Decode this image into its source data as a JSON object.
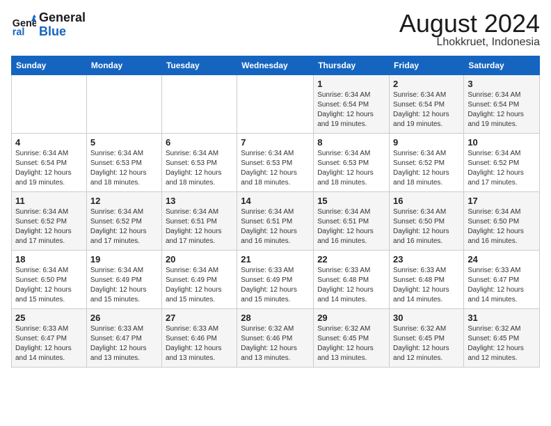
{
  "header": {
    "logo_line1": "General",
    "logo_line2": "Blue",
    "title": "August 2024",
    "subtitle": "Lhokkruet, Indonesia"
  },
  "weekdays": [
    "Sunday",
    "Monday",
    "Tuesday",
    "Wednesday",
    "Thursday",
    "Friday",
    "Saturday"
  ],
  "weeks": [
    [
      {
        "day": "",
        "info": ""
      },
      {
        "day": "",
        "info": ""
      },
      {
        "day": "",
        "info": ""
      },
      {
        "day": "",
        "info": ""
      },
      {
        "day": "1",
        "info": "Sunrise: 6:34 AM\nSunset: 6:54 PM\nDaylight: 12 hours\nand 19 minutes."
      },
      {
        "day": "2",
        "info": "Sunrise: 6:34 AM\nSunset: 6:54 PM\nDaylight: 12 hours\nand 19 minutes."
      },
      {
        "day": "3",
        "info": "Sunrise: 6:34 AM\nSunset: 6:54 PM\nDaylight: 12 hours\nand 19 minutes."
      }
    ],
    [
      {
        "day": "4",
        "info": "Sunrise: 6:34 AM\nSunset: 6:54 PM\nDaylight: 12 hours\nand 19 minutes."
      },
      {
        "day": "5",
        "info": "Sunrise: 6:34 AM\nSunset: 6:53 PM\nDaylight: 12 hours\nand 18 minutes."
      },
      {
        "day": "6",
        "info": "Sunrise: 6:34 AM\nSunset: 6:53 PM\nDaylight: 12 hours\nand 18 minutes."
      },
      {
        "day": "7",
        "info": "Sunrise: 6:34 AM\nSunset: 6:53 PM\nDaylight: 12 hours\nand 18 minutes."
      },
      {
        "day": "8",
        "info": "Sunrise: 6:34 AM\nSunset: 6:53 PM\nDaylight: 12 hours\nand 18 minutes."
      },
      {
        "day": "9",
        "info": "Sunrise: 6:34 AM\nSunset: 6:52 PM\nDaylight: 12 hours\nand 18 minutes."
      },
      {
        "day": "10",
        "info": "Sunrise: 6:34 AM\nSunset: 6:52 PM\nDaylight: 12 hours\nand 17 minutes."
      }
    ],
    [
      {
        "day": "11",
        "info": "Sunrise: 6:34 AM\nSunset: 6:52 PM\nDaylight: 12 hours\nand 17 minutes."
      },
      {
        "day": "12",
        "info": "Sunrise: 6:34 AM\nSunset: 6:52 PM\nDaylight: 12 hours\nand 17 minutes."
      },
      {
        "day": "13",
        "info": "Sunrise: 6:34 AM\nSunset: 6:51 PM\nDaylight: 12 hours\nand 17 minutes."
      },
      {
        "day": "14",
        "info": "Sunrise: 6:34 AM\nSunset: 6:51 PM\nDaylight: 12 hours\nand 16 minutes."
      },
      {
        "day": "15",
        "info": "Sunrise: 6:34 AM\nSunset: 6:51 PM\nDaylight: 12 hours\nand 16 minutes."
      },
      {
        "day": "16",
        "info": "Sunrise: 6:34 AM\nSunset: 6:50 PM\nDaylight: 12 hours\nand 16 minutes."
      },
      {
        "day": "17",
        "info": "Sunrise: 6:34 AM\nSunset: 6:50 PM\nDaylight: 12 hours\nand 16 minutes."
      }
    ],
    [
      {
        "day": "18",
        "info": "Sunrise: 6:34 AM\nSunset: 6:50 PM\nDaylight: 12 hours\nand 15 minutes."
      },
      {
        "day": "19",
        "info": "Sunrise: 6:34 AM\nSunset: 6:49 PM\nDaylight: 12 hours\nand 15 minutes."
      },
      {
        "day": "20",
        "info": "Sunrise: 6:34 AM\nSunset: 6:49 PM\nDaylight: 12 hours\nand 15 minutes."
      },
      {
        "day": "21",
        "info": "Sunrise: 6:33 AM\nSunset: 6:49 PM\nDaylight: 12 hours\nand 15 minutes."
      },
      {
        "day": "22",
        "info": "Sunrise: 6:33 AM\nSunset: 6:48 PM\nDaylight: 12 hours\nand 14 minutes."
      },
      {
        "day": "23",
        "info": "Sunrise: 6:33 AM\nSunset: 6:48 PM\nDaylight: 12 hours\nand 14 minutes."
      },
      {
        "day": "24",
        "info": "Sunrise: 6:33 AM\nSunset: 6:47 PM\nDaylight: 12 hours\nand 14 minutes."
      }
    ],
    [
      {
        "day": "25",
        "info": "Sunrise: 6:33 AM\nSunset: 6:47 PM\nDaylight: 12 hours\nand 14 minutes."
      },
      {
        "day": "26",
        "info": "Sunrise: 6:33 AM\nSunset: 6:47 PM\nDaylight: 12 hours\nand 13 minutes."
      },
      {
        "day": "27",
        "info": "Sunrise: 6:33 AM\nSunset: 6:46 PM\nDaylight: 12 hours\nand 13 minutes."
      },
      {
        "day": "28",
        "info": "Sunrise: 6:32 AM\nSunset: 6:46 PM\nDaylight: 12 hours\nand 13 minutes."
      },
      {
        "day": "29",
        "info": "Sunrise: 6:32 AM\nSunset: 6:45 PM\nDaylight: 12 hours\nand 13 minutes."
      },
      {
        "day": "30",
        "info": "Sunrise: 6:32 AM\nSunset: 6:45 PM\nDaylight: 12 hours\nand 12 minutes."
      },
      {
        "day": "31",
        "info": "Sunrise: 6:32 AM\nSunset: 6:45 PM\nDaylight: 12 hours\nand 12 minutes."
      }
    ]
  ]
}
